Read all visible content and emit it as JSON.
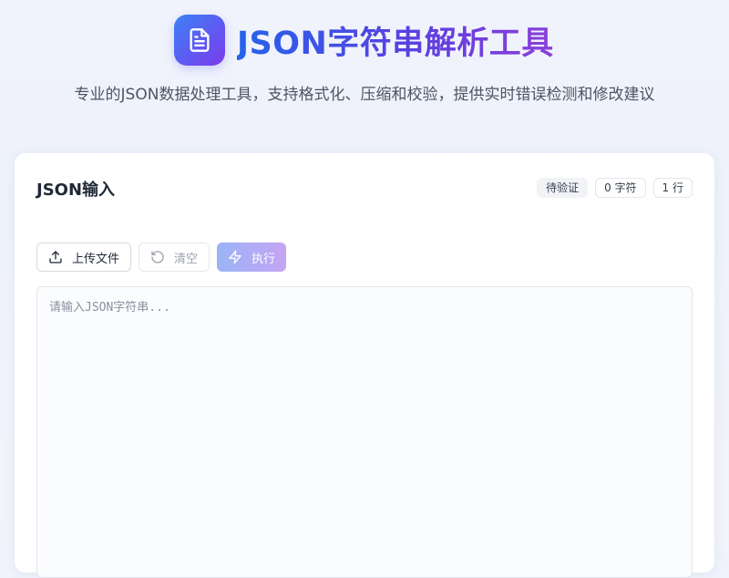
{
  "header": {
    "logo_icon": "document-icon",
    "title": "JSON字符串解析工具",
    "subtitle": "专业的JSON数据处理工具，支持格式化、压缩和校验，提供实时错误检测和修改建议"
  },
  "input_card": {
    "title": "JSON输入",
    "badges": {
      "status": "待验证",
      "chars": "0 字符",
      "lines": "1 行"
    },
    "toolbar": {
      "upload_label": "上传文件",
      "upload_icon": "upload-icon",
      "clear_label": "清空",
      "clear_icon": "rotate-ccw-icon",
      "execute_label": "执行",
      "execute_icon": "lightning-icon"
    },
    "editor": {
      "value": "",
      "placeholder": "请输入JSON字符串..."
    }
  },
  "colors": {
    "brand_start": "#3b82f6",
    "brand_end": "#7c3aed"
  }
}
